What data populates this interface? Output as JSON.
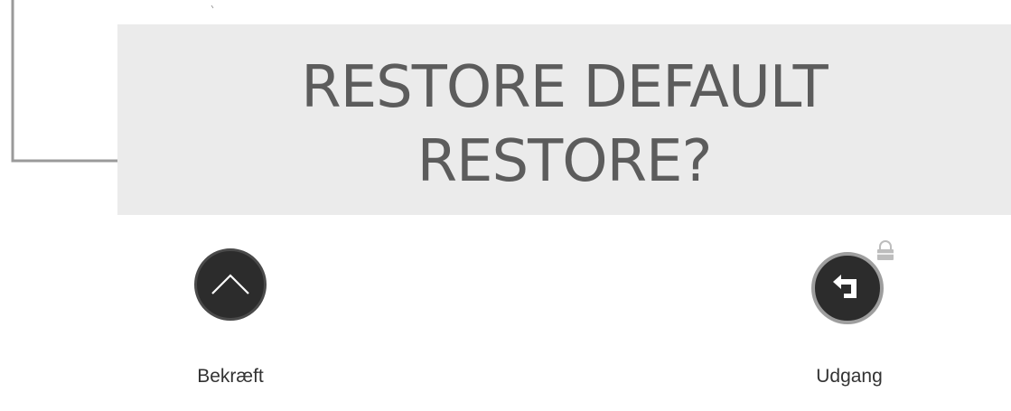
{
  "display": {
    "line1": "RESTORE DEFAULT",
    "line2": "RESTORE?",
    "background": "#ebebeb",
    "text_color": "#5c5c5c"
  },
  "buttons": {
    "confirm": {
      "icon": "chevron-up-icon",
      "label": "Bekræft"
    },
    "exit": {
      "icon": "return-arrow-icon",
      "label": "Udgang",
      "badge_icon": "lock-icon"
    }
  }
}
